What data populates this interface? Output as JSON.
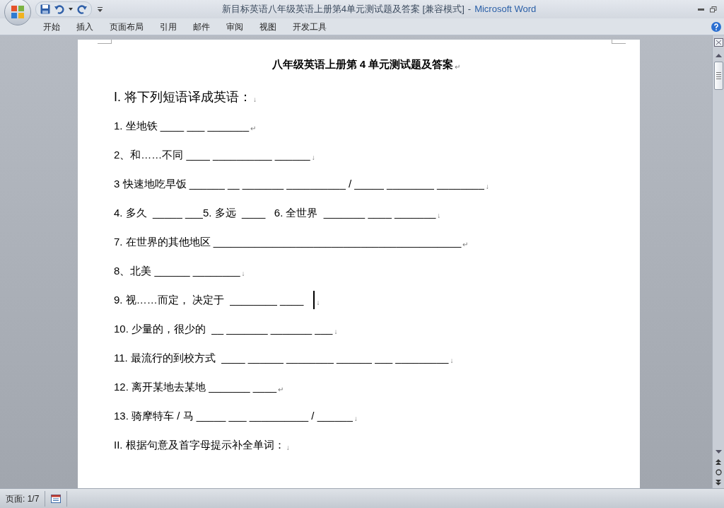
{
  "window": {
    "document_title": "新目标英语八年级英语上册第4单元测试题及答案 [兼容模式]",
    "separator": "-",
    "app_name": "Microsoft Word"
  },
  "ribbon_tabs": [
    {
      "label": "开始",
      "selected": false
    },
    {
      "label": "插入",
      "selected": false
    },
    {
      "label": "页面布局",
      "selected": false
    },
    {
      "label": "引用",
      "selected": false
    },
    {
      "label": "邮件",
      "selected": false
    },
    {
      "label": "审阅",
      "selected": false
    },
    {
      "label": "视图",
      "selected": false
    },
    {
      "label": "开发工具",
      "selected": false
    }
  ],
  "document": {
    "lines": [
      {
        "kind": "title",
        "text": "八年级英语上册第 4 单元测试题及答案",
        "mark": "↵",
        "caret": false
      },
      {
        "kind": "heading",
        "text": "I. 将下列短语译成英语：",
        "mark": "↓",
        "caret": false
      },
      {
        "kind": "item",
        "text": "1. 坐地铁 ____ ___ _______",
        "mark": "↵",
        "caret": false
      },
      {
        "kind": "item",
        "text": "2、和……不同 ____ __________ ______",
        "mark": "↓",
        "caret": false
      },
      {
        "kind": "item",
        "text": "3 快速地吃早饭 ______ __ _______ __________ / _____ ________ ________",
        "mark": "↓",
        "caret": false
      },
      {
        "kind": "item",
        "text": "4. 多久  _____ ___5. 多远  ____   6. 全世界  _______ ____ _______",
        "mark": "↓",
        "caret": false
      },
      {
        "kind": "item",
        "text": "7. 在世界的其他地区 __________________________________________",
        "mark": "↵",
        "caret": false
      },
      {
        "kind": "item",
        "text": "8、北美 ______ ________",
        "mark": "↓",
        "caret": false
      },
      {
        "kind": "item",
        "text": "9. 视……而定， 决定于  ________ ____",
        "mark": "↓",
        "caret": true
      },
      {
        "kind": "item",
        "text": "10. 少量的，很少的  __ _______ _______ ___",
        "mark": "↓",
        "caret": false
      },
      {
        "kind": "item",
        "text": "11. 最流行的到校方式  ____ ______ ________ ______ ___ _________",
        "mark": "↓",
        "caret": false
      },
      {
        "kind": "item",
        "text": "12. 离开某地去某地 _______ ____",
        "mark": "↵",
        "caret": false
      },
      {
        "kind": "item",
        "text": "13. 骑摩特车 / 马 _____ ___ __________ / ______",
        "mark": "↓",
        "caret": false
      },
      {
        "kind": "heading2",
        "text": "II. 根据句意及首字母提示补全单词：",
        "mark": "↓",
        "caret": false
      }
    ]
  },
  "status_bar": {
    "page": "页面: 1/7"
  }
}
